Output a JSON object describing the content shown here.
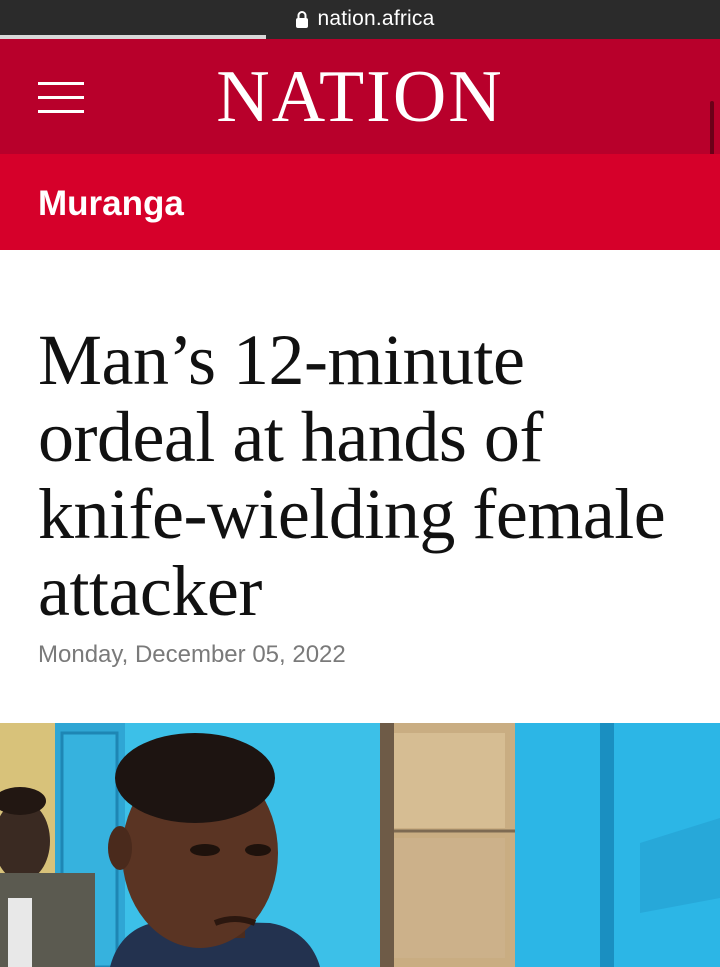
{
  "browser": {
    "url": "nation.africa",
    "lock_icon": "lock-icon",
    "page_load_progress": 0.37
  },
  "masthead": {
    "logo_text": "NATION",
    "menu_icon": "hamburger-menu-icon",
    "brand_color": "#b8002b"
  },
  "section": {
    "label": "Muranga",
    "color": "#d6002a"
  },
  "article": {
    "headline": "Man’s 12-minute ordeal at hands of knife-wielding female attacker",
    "date": "Monday, December 05, 2022"
  },
  "hero_image": {
    "subject": "photo-of-young-man"
  }
}
